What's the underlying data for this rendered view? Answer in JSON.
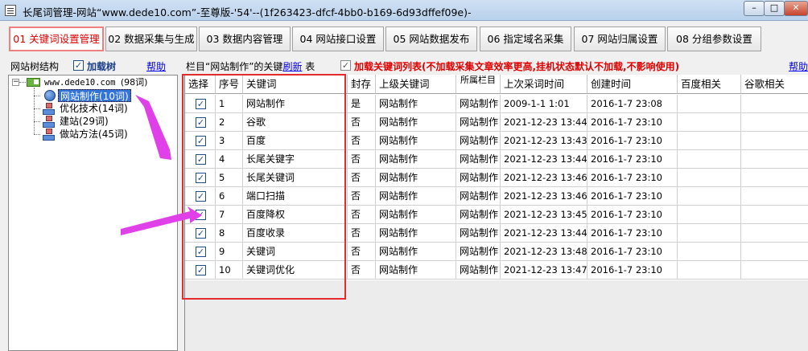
{
  "window": {
    "title": "长尾词管理-网站“www.dede10.com”-至尊版-'54'--(1f263423-dfcf-4bb0-b169-6d93dffef09e)-",
    "minimize_label": "–",
    "maximize_label": "□",
    "close_label": "✕"
  },
  "tabs": [
    {
      "label": "01 关键词设置管理",
      "active": true
    },
    {
      "label": "02 数据采集与生成",
      "active": false
    },
    {
      "label": "03 数据内容管理",
      "active": false
    },
    {
      "label": "04 网站接口设置",
      "active": false
    },
    {
      "label": "05 网站数据发布",
      "active": false
    },
    {
      "label": "06 指定域名采集",
      "active": false
    },
    {
      "label": "07 网站归属设置",
      "active": false
    },
    {
      "label": "08 分组参数设置",
      "active": false
    }
  ],
  "left_panel": {
    "title": "网站树结构",
    "load_tree_checked": true,
    "load_tree_label": "加载树",
    "help_label": "帮助",
    "tree": {
      "root": {
        "label": "www.dede10.com",
        "count": "(98词)"
      },
      "children": [
        {
          "label": "网站制作",
          "count": "(10词)",
          "selected": true
        },
        {
          "label": "优化技术",
          "count": "(14词)",
          "selected": false
        },
        {
          "label": "建站",
          "count": "(29词)",
          "selected": false
        },
        {
          "label": "做站方法",
          "count": "(45词)",
          "selected": false
        }
      ]
    }
  },
  "right_panel": {
    "title_prefix": "栏目“网站制作”的关键",
    "refresh_label": "刷新",
    "title_suffix": "表",
    "load_keywords_checked": true,
    "load_keywords_label": "加载关键词列表(不加载采集文章效率更高,挂机状态默认不加载,不影响使用)",
    "help_label": "帮助"
  },
  "grid": {
    "columns": [
      "选择",
      "序号",
      "关键词",
      "封存",
      "上级关键词",
      "所属栏目",
      "上次采词时间",
      "创建时间",
      "百度相关",
      "谷歌相关"
    ],
    "rows": [
      {
        "checked": true,
        "no": "1",
        "keyword": "网站制作",
        "sealed": "是",
        "parent": "网站制作",
        "column": "网站制作",
        "last": "2009-1-1 1:01",
        "created": "2016-1-7 23:08",
        "baidu": "",
        "google": ""
      },
      {
        "checked": true,
        "no": "2",
        "keyword": "谷歌",
        "sealed": "否",
        "parent": "网站制作",
        "column": "网站制作",
        "last": "2021-12-23 13:44",
        "created": "2016-1-7 23:10",
        "baidu": "",
        "google": ""
      },
      {
        "checked": true,
        "no": "3",
        "keyword": "百度",
        "sealed": "否",
        "parent": "网站制作",
        "column": "网站制作",
        "last": "2021-12-23 13:43",
        "created": "2016-1-7 23:10",
        "baidu": "",
        "google": ""
      },
      {
        "checked": true,
        "no": "4",
        "keyword": "长尾关键字",
        "sealed": "否",
        "parent": "网站制作",
        "column": "网站制作",
        "last": "2021-12-23 13:44",
        "created": "2016-1-7 23:10",
        "baidu": "",
        "google": ""
      },
      {
        "checked": true,
        "no": "5",
        "keyword": "长尾关键词",
        "sealed": "否",
        "parent": "网站制作",
        "column": "网站制作",
        "last": "2021-12-23 13:46",
        "created": "2016-1-7 23:10",
        "baidu": "",
        "google": ""
      },
      {
        "checked": true,
        "no": "6",
        "keyword": "端口扫描",
        "sealed": "否",
        "parent": "网站制作",
        "column": "网站制作",
        "last": "2021-12-23 13:46",
        "created": "2016-1-7 23:10",
        "baidu": "",
        "google": ""
      },
      {
        "checked": true,
        "no": "7",
        "keyword": "百度降权",
        "sealed": "否",
        "parent": "网站制作",
        "column": "网站制作",
        "last": "2021-12-23 13:45",
        "created": "2016-1-7 23:10",
        "baidu": "",
        "google": ""
      },
      {
        "checked": true,
        "no": "8",
        "keyword": "百度收录",
        "sealed": "否",
        "parent": "网站制作",
        "column": "网站制作",
        "last": "2021-12-23 13:44",
        "created": "2016-1-7 23:10",
        "baidu": "",
        "google": ""
      },
      {
        "checked": true,
        "no": "9",
        "keyword": "关键词",
        "sealed": "否",
        "parent": "网站制作",
        "column": "网站制作",
        "last": "2021-12-23 13:48",
        "created": "2016-1-7 23:10",
        "baidu": "",
        "google": ""
      },
      {
        "checked": true,
        "no": "10",
        "keyword": "关键词优化",
        "sealed": "否",
        "parent": "网站制作",
        "column": "网站制作",
        "last": "2021-12-23 13:47",
        "created": "2016-1-7 23:10",
        "baidu": "",
        "google": ""
      }
    ]
  },
  "annotations": {
    "highlight_color": "#e52b2b",
    "arrow_color": "#e040e8"
  }
}
